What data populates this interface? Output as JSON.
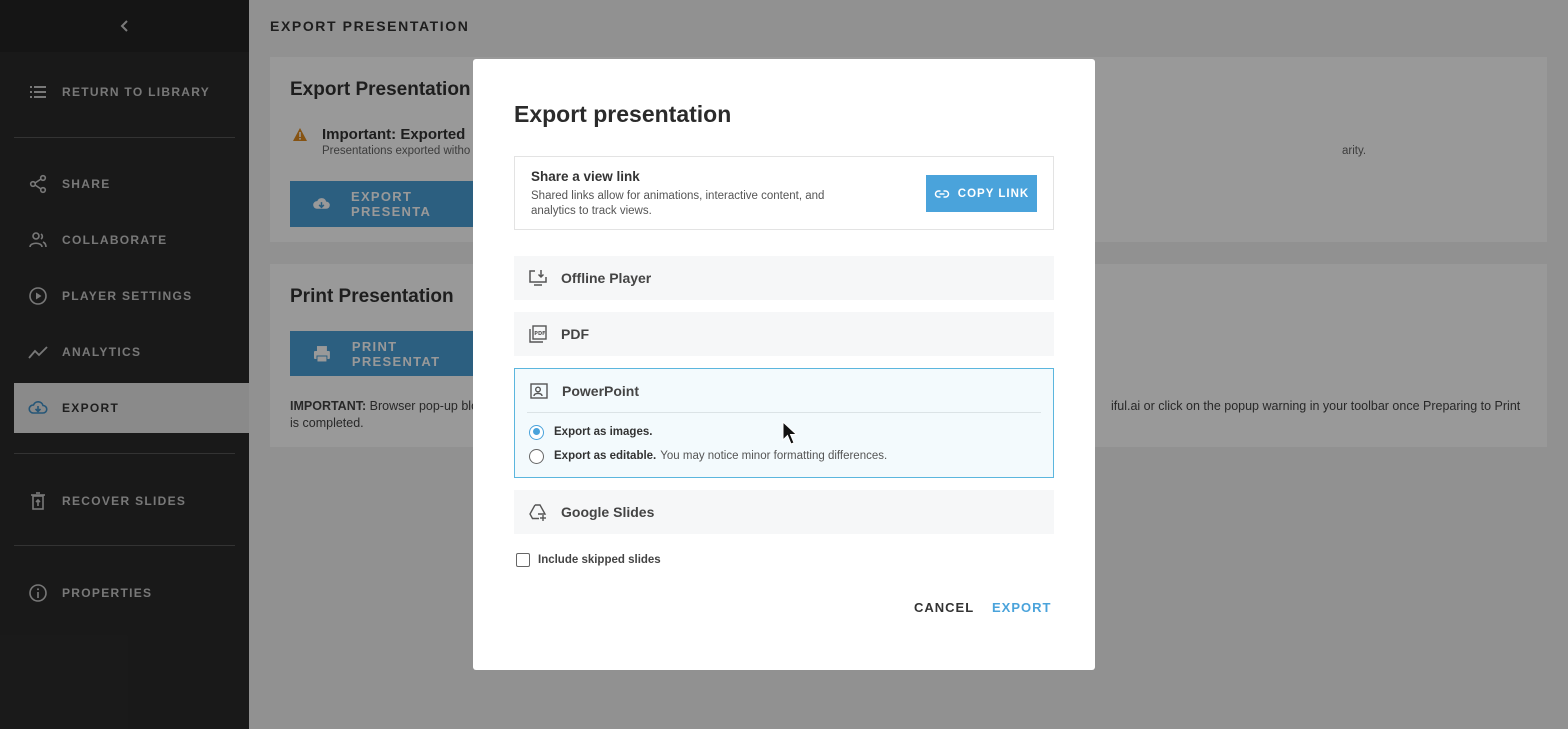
{
  "sidebar": {
    "back_label": "",
    "items": [
      {
        "label": "RETURN TO LIBRARY",
        "icon": "list-icon"
      },
      {
        "label": "SHARE",
        "icon": "share-icon"
      },
      {
        "label": "COLLABORATE",
        "icon": "users-icon"
      },
      {
        "label": "PLAYER SETTINGS",
        "icon": "play-circle-icon"
      },
      {
        "label": "ANALYTICS",
        "icon": "trend-line-icon"
      },
      {
        "label": "EXPORT",
        "icon": "cloud-download-icon",
        "active": true
      },
      {
        "label": "RECOVER SLIDES",
        "icon": "trash-restore-icon"
      },
      {
        "label": "PROPERTIES",
        "icon": "info-icon"
      }
    ]
  },
  "main": {
    "header": "EXPORT PRESENTATION",
    "export_card": {
      "title": "Export Presentation",
      "warning_title": "Important: Exported",
      "warning_sub_left": "Presentations exported witho",
      "warning_sub_right": "arity.",
      "button_label": "EXPORT PRESENTA"
    },
    "print_card": {
      "title": "Print Presentation",
      "button_label": "PRINT PRESENTAT",
      "important_label": "IMPORTANT:",
      "important_text_left": " Browser pop-up blo",
      "important_text_right": "iful.ai or click on the popup warning in your toolbar once Preparing to Print",
      "important_text_line2": "is completed."
    }
  },
  "modal": {
    "title": "Export presentation",
    "share": {
      "title": "Share a view link",
      "description": "Shared links allow for animations, interactive content, and analytics to track views.",
      "copy_label": "COPY LINK"
    },
    "options": {
      "offline": "Offline Player",
      "pdf": "PDF",
      "powerpoint": "PowerPoint",
      "google": "Google Slides"
    },
    "powerpoint_choices": [
      {
        "strong": "Export as images.",
        "muted": "",
        "checked": true
      },
      {
        "strong": "Export as editable.",
        "muted": "You may notice minor formatting differences.",
        "checked": false
      }
    ],
    "include_skipped": "Include skipped slides",
    "cancel_label": "CANCEL",
    "export_label": "EXPORT"
  },
  "colors": {
    "accent": "#4aa3db",
    "sidebar_bg": "#2b2b2b",
    "warning": "#e08a1e"
  }
}
